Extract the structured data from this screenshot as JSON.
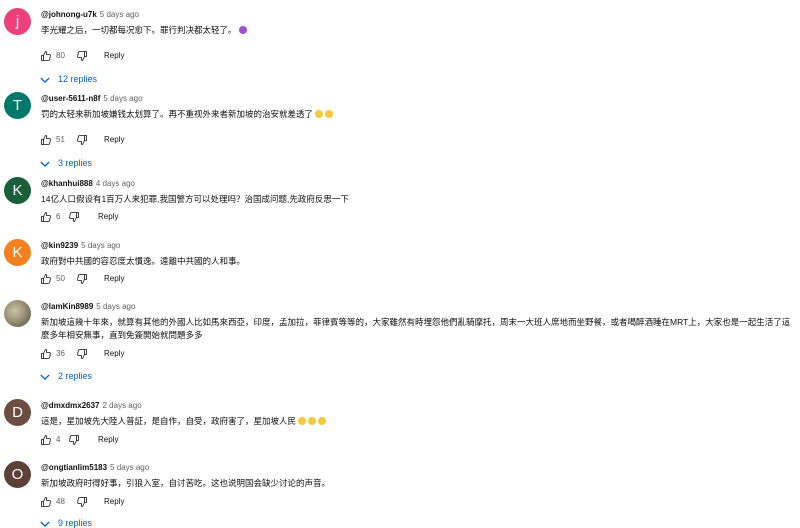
{
  "colors": {
    "link": "#065fd4",
    "secondary_text": "#606060"
  },
  "comments": [
    {
      "handle": "@johnong-u7k",
      "time": "5 days ago",
      "avatar_letter": "j",
      "avatar_color": "#ec407a",
      "text": "李光耀之后，一切都每况愈下。罪行判决都太轻了。",
      "emoji_icon": "violet-face-icon",
      "likes": "80",
      "reply_label": "Reply",
      "replies_label": "12 replies"
    },
    {
      "handle": "@user-5611-n8f",
      "time": "5 days ago",
      "avatar_letter": "T",
      "avatar_color": "#00796b",
      "text": "罚的太轻来新加坡嫌钱太划算了。再不重视外来者新加坡的治安就差透了",
      "emoji_icon": "grinning-face-icon x2",
      "likes": "51",
      "reply_label": "Reply",
      "replies_label": "3 replies"
    },
    {
      "handle": "@khanhui888",
      "time": "4 days ago",
      "avatar_letter": "K",
      "avatar_color": "#1b5e3b",
      "text": "14亿人口假设有1百万人来犯罪,我国警方可以处理吗？治国成问题,先政府反思一下",
      "likes": "6",
      "reply_label": "Reply"
    },
    {
      "handle": "@kin9239",
      "time": "5 days ago",
      "avatar_letter": "K",
      "avatar_color": "#f4811f",
      "text": "政府對中共國的容忍度太慣逸。遠離中共國的人和事。",
      "likes": "50",
      "reply_label": "Reply"
    },
    {
      "handle": "@lamKin8989",
      "time": "5 days ago",
      "avatar_letter": "",
      "avatar_color": "#8a846a",
      "text": "新加坡這幾十年來，就算有其他的外國人比如馬來西亞，印度，孟加拉，菲律賓等等的，大家雖然有時埋怨他們亂騎摩托，周末一大班人席地而坐野餐，或者喝醉酒睡在MRT上，大家也是一起生活了這麼多年相安無事，直到免簽開始就問題多多",
      "likes": "36",
      "reply_label": "Reply",
      "replies_label": "2 replies"
    },
    {
      "handle": "@dmxdmx2637",
      "time": "2 days ago",
      "avatar_letter": "D",
      "avatar_color": "#6d4c41",
      "text": "這是，星加坡先大陸人普証，是自作，自受，政府害了，星加坡人民",
      "emoji_icon": "sad-face-icon x3",
      "likes": "4",
      "reply_label": "Reply"
    },
    {
      "handle": "@ongtianlim5183",
      "time": "5 days ago",
      "avatar_letter": "O",
      "avatar_color": "#5d4037",
      "text": "新加坡政府时得好事，引狼入室，自讨苦吃。这也说明国会缺少讨论的声音。",
      "likes": "48",
      "reply_label": "Reply",
      "replies_label": "9 replies"
    }
  ]
}
